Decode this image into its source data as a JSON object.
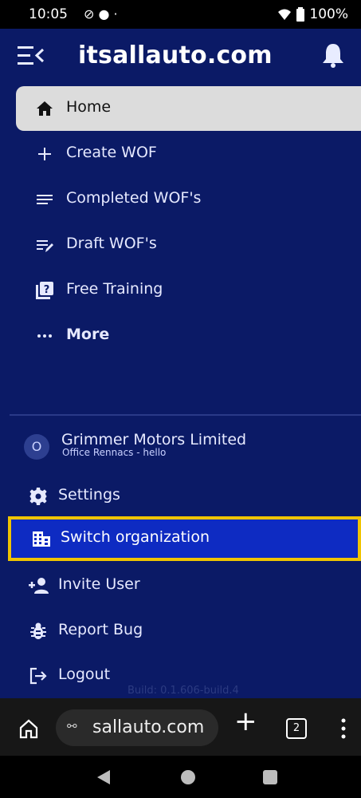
{
  "status_bar": {
    "time": "10:05",
    "battery": "100%"
  },
  "header": {
    "title": "itsallauto.com"
  },
  "nav": {
    "home": "Home",
    "create_wof": "Create WOF",
    "completed_wofs": "Completed WOF's",
    "draft_wofs": "Draft WOF's",
    "free_training": "Free Training",
    "more": "More"
  },
  "org": {
    "avatar_initial": "O",
    "name": "Grimmer Motors Limited",
    "subtitle": "Office Rennacs - hello"
  },
  "bottom": {
    "settings": "Settings",
    "switch_org": "Switch organization",
    "invite_user": "Invite User",
    "report_bug": "Report Bug",
    "logout": "Logout"
  },
  "build": "Build: 0.1.606-build.4",
  "browser": {
    "url": "sallauto.com",
    "tab_count": "2"
  },
  "colors": {
    "drawer_bg": "#0b1a66",
    "highlight": "#0e2bc2",
    "focus_border": "#f0c400"
  }
}
